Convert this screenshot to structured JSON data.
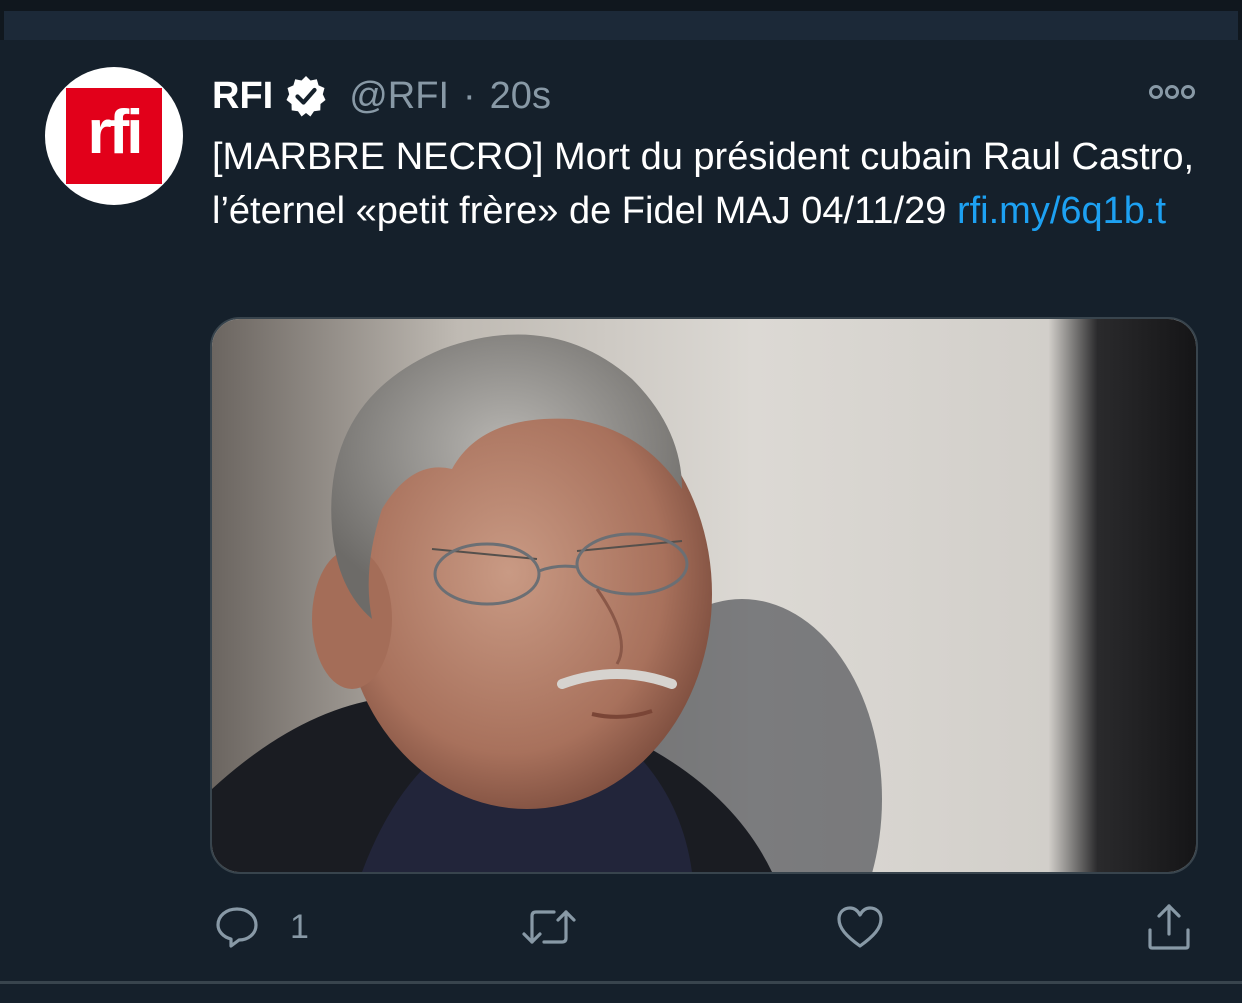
{
  "tweet": {
    "display_name": "RFI",
    "handle": "@RFI",
    "separator": "·",
    "time": "20s",
    "avatar_text": "rfi",
    "verified": true,
    "text_main": "[MARBRE NECRO] Mort du président cubain Raul Castro, l’éternel «petit frère» de Fidel MAJ 04/11/29",
    "link": "rfi.my/6q1b.t",
    "media": {
      "subject": "photo-of-elderly-man-with-glasses"
    },
    "reply_count": "1"
  },
  "icons": {
    "verified": "verified-badge-icon",
    "more": "more-options-icon",
    "reply": "reply-icon",
    "retweet": "retweet-icon",
    "like": "like-icon",
    "share": "share-icon"
  },
  "colors": {
    "background": "#15202b",
    "text_primary": "#ffffff",
    "text_secondary": "#8899a6",
    "link": "#1da1f2",
    "brand_red": "#e2001a",
    "border": "#38444d"
  }
}
